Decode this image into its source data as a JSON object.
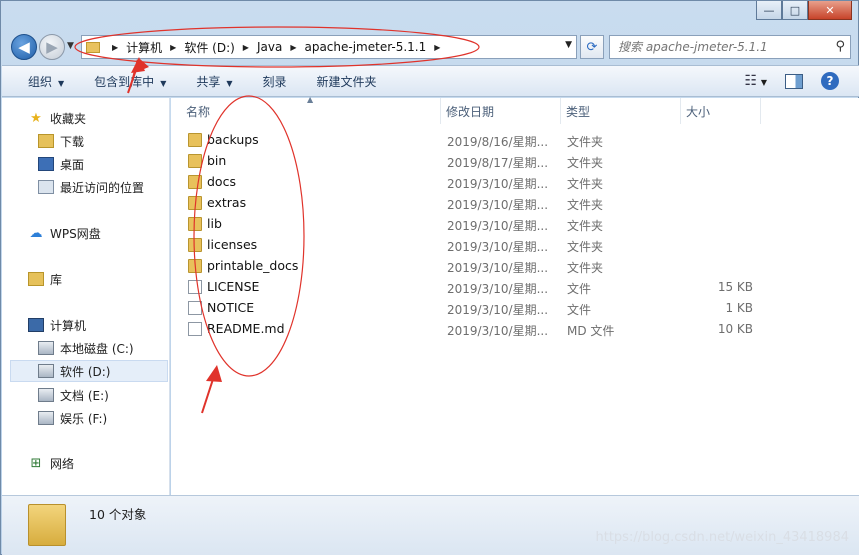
{
  "window": {
    "controls": [
      "—",
      "□",
      "✕"
    ]
  },
  "address": {
    "crumbs": [
      "计算机",
      "软件 (D:)",
      "Java",
      "apache-jmeter-5.1.1"
    ]
  },
  "search": {
    "placeholder": "搜索 apache-jmeter-5.1.1"
  },
  "toolbar": {
    "items": [
      "组织",
      "包含到库中",
      "共享",
      "刻录",
      "新建文件夹"
    ]
  },
  "sidebar": {
    "favorites": "收藏夹",
    "downloads": "下载",
    "desktop": "桌面",
    "recent": "最近访问的位置",
    "wps": "WPS网盘",
    "library": "库",
    "computer": "计算机",
    "drive_c": "本地磁盘 (C:)",
    "drive_d": "软件 (D:)",
    "drive_e": "文档 (E:)",
    "drive_f": "娱乐 (F:)",
    "network": "网络"
  },
  "columns": {
    "name": "名称",
    "date": "修改日期",
    "type": "类型",
    "size": "大小"
  },
  "files": [
    {
      "name": "backups",
      "date": "2019/8/16/星期...",
      "type": "文件夹",
      "size": "",
      "icon": "folder"
    },
    {
      "name": "bin",
      "date": "2019/8/17/星期...",
      "type": "文件夹",
      "size": "",
      "icon": "folder"
    },
    {
      "name": "docs",
      "date": "2019/3/10/星期...",
      "type": "文件夹",
      "size": "",
      "icon": "folder"
    },
    {
      "name": "extras",
      "date": "2019/3/10/星期...",
      "type": "文件夹",
      "size": "",
      "icon": "folder"
    },
    {
      "name": "lib",
      "date": "2019/3/10/星期...",
      "type": "文件夹",
      "size": "",
      "icon": "folder"
    },
    {
      "name": "licenses",
      "date": "2019/3/10/星期...",
      "type": "文件夹",
      "size": "",
      "icon": "folder"
    },
    {
      "name": "printable_docs",
      "date": "2019/3/10/星期...",
      "type": "文件夹",
      "size": "",
      "icon": "folder"
    },
    {
      "name": "LICENSE",
      "date": "2019/3/10/星期...",
      "type": "文件",
      "size": "15 KB",
      "icon": "file"
    },
    {
      "name": "NOTICE",
      "date": "2019/3/10/星期...",
      "type": "文件",
      "size": "1 KB",
      "icon": "file"
    },
    {
      "name": "README.md",
      "date": "2019/3/10/星期...",
      "type": "MD 文件",
      "size": "10 KB",
      "icon": "file"
    }
  ],
  "status": {
    "count": "10 个对象",
    "watermark": "https://blog.csdn.net/weixin_43418984"
  },
  "annotation_color": "#e0332b"
}
